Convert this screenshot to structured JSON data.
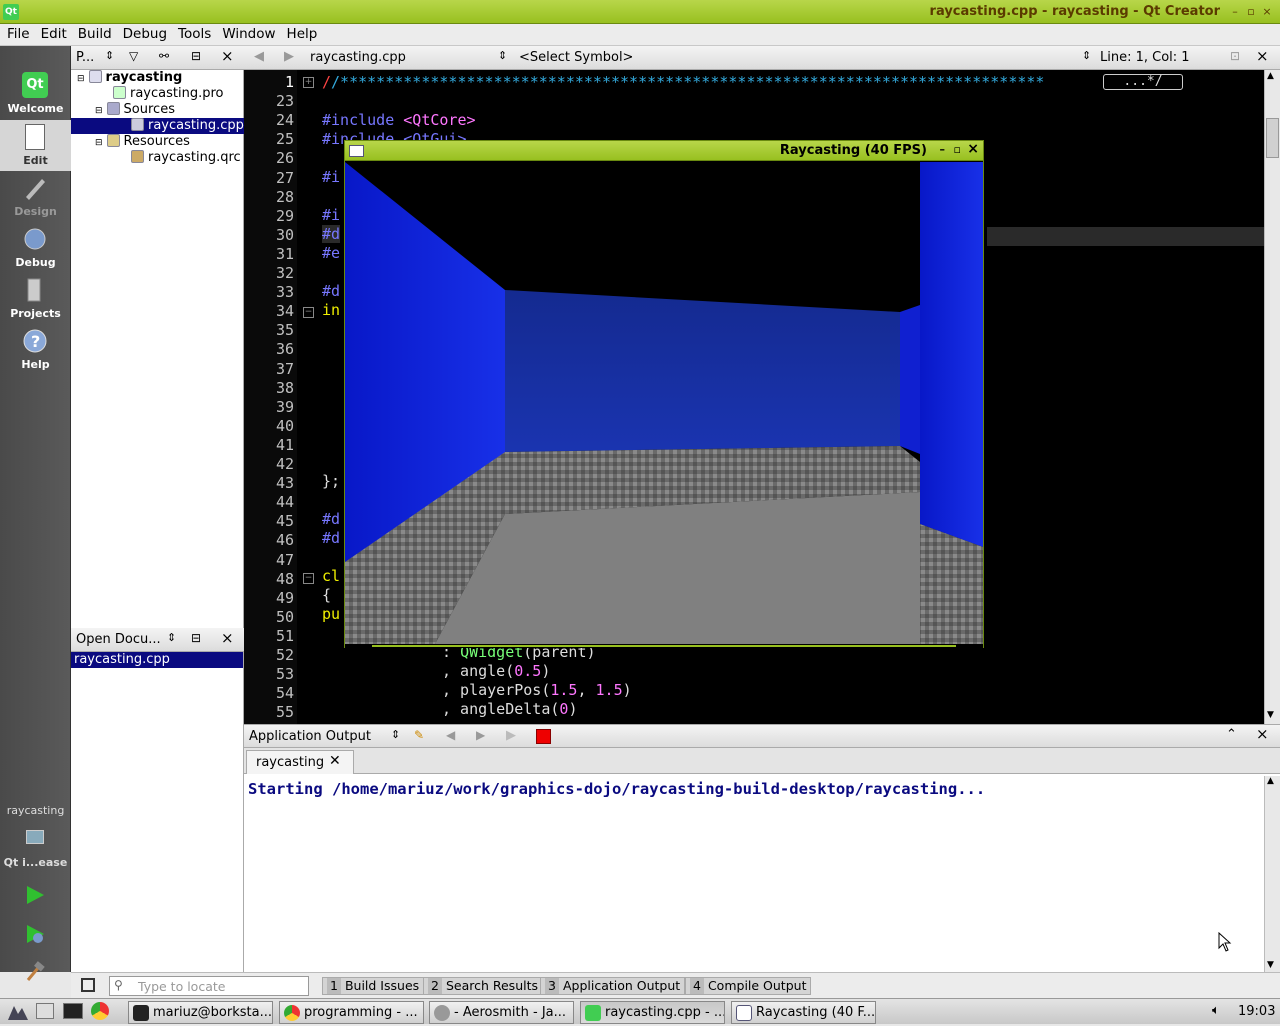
{
  "window": {
    "title": "raycasting.cpp - raycasting - Qt Creator",
    "min": "–",
    "max": "▫",
    "close": "×",
    "logo": "Qt"
  },
  "menu": [
    "File",
    "Edit",
    "Build",
    "Debug",
    "Tools",
    "Window",
    "Help"
  ],
  "modes": [
    {
      "label": "Welcome",
      "icon": "qt-logo-icon"
    },
    {
      "label": "Edit",
      "icon": "edit-document-icon"
    },
    {
      "label": "Design",
      "icon": "design-pen-icon"
    },
    {
      "label": "Debug",
      "icon": "debug-bug-icon"
    },
    {
      "label": "Projects",
      "icon": "projects-book-icon"
    },
    {
      "label": "Help",
      "icon": "help-icon"
    }
  ],
  "run": {
    "project": "raycasting",
    "target": "Qt i...ease"
  },
  "projects_panel": {
    "title": "P...",
    "tree": [
      {
        "label": "raycasting",
        "level": 0,
        "bold": true
      },
      {
        "label": "raycasting.pro",
        "level": 1
      },
      {
        "label": "Sources",
        "level": 1
      },
      {
        "label": "raycasting.cpp",
        "level": 2,
        "selected": true
      },
      {
        "label": "Resources",
        "level": 1
      },
      {
        "label": "raycasting.qrc",
        "level": 2
      }
    ]
  },
  "open_docs": {
    "title": "Open Docu...",
    "items": [
      "raycasting.cpp"
    ]
  },
  "editor": {
    "file": "raycasting.cpp",
    "symbol": "<Select Symbol>",
    "position": "Line: 1, Col: 1",
    "line_numbers": [
      "1",
      "23",
      "24",
      "25",
      "26",
      "27",
      "28",
      "29",
      "30",
      "31",
      "32",
      "33",
      "34",
      "35",
      "36",
      "37",
      "38",
      "39",
      "40",
      "41",
      "42",
      "43",
      "44",
      "45",
      "46",
      "47",
      "48",
      "49",
      "50",
      "51",
      "52",
      "53",
      "54",
      "55"
    ],
    "fold_badge": "...*/",
    "line1": "/******************************************************************************",
    "l24a": "#include",
    "l24b": "<QtCore>",
    "l25": "#include <QtGui>",
    "l27": "#i",
    "l29": "#i",
    "l30": "#d",
    "l31": "#e",
    "l33": "#d",
    "l34": "in",
    "l43": "};",
    "l45": "#d",
    "l46": "#d",
    "l48": "cl",
    "l49": "{",
    "l50": "pu",
    "l52a": ": ",
    "l52b": "QWidget",
    "l52c": "(parent)",
    "l53a": ", angle(",
    "l53b": "0.5",
    "l53c": ")",
    "l54a": ", playerPos(",
    "l54b": "1.5",
    "l54c": ", ",
    "l54d": "1.5",
    "l54e": ")",
    "l55a": ", angleDelta(",
    "l55b": "0",
    "l55c": ")"
  },
  "raycast_window": {
    "title": "Raycasting (40 FPS)",
    "min": "–",
    "max": "▫",
    "close": "×"
  },
  "output": {
    "selector": "Application Output",
    "tab": "raycasting",
    "text": "Starting /home/mariuz/work/graphics-dojo/raycasting-build-desktop/raycasting..."
  },
  "status": {
    "locate_placeholder": "Type to locate",
    "tabs": [
      {
        "n": "1",
        "label": "Build Issues"
      },
      {
        "n": "2",
        "label": "Search Results"
      },
      {
        "n": "3",
        "label": "Application Output"
      },
      {
        "n": "4",
        "label": "Compile Output"
      }
    ]
  },
  "taskbar": {
    "tasks": [
      "mariuz@borksta...",
      "programming - ...",
      "- Aerosmith - Ja...",
      "raycasting.cpp - ...",
      "Raycasting (40 F..."
    ],
    "clock": "19:03"
  },
  "colors": {
    "accent": "#98c020",
    "keyword": "#7777ff",
    "string": "#ff77ff",
    "selection": "#0a0a80",
    "wall": "#1020d0",
    "output_text": "#0a0a80"
  }
}
